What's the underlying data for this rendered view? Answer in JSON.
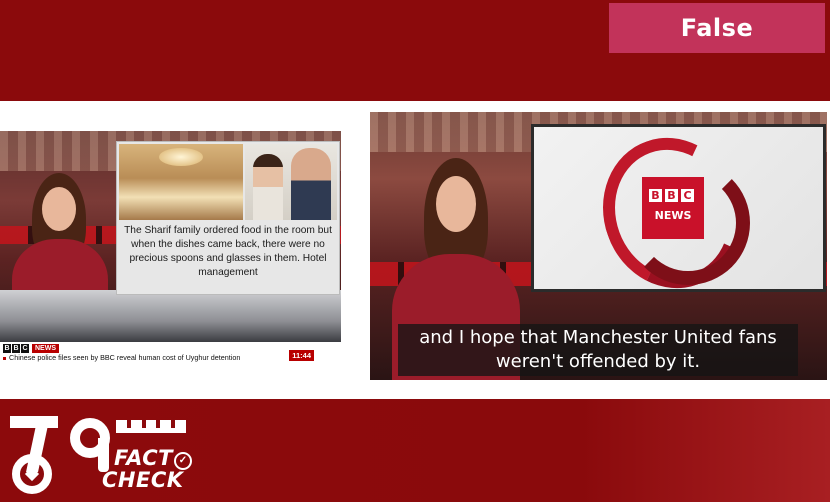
{
  "verdict": {
    "label": "False",
    "color": "#c2335a"
  },
  "left_frame": {
    "inset_caption": "The Sharif family ordered food in the room but when the dishes came back, there were no precious spoons and glasses in them. Hotel management",
    "channel_blocks": [
      "B",
      "B",
      "C"
    ],
    "channel_name": "NEWS",
    "ticker": "Chinese police files seen by BBC reveal human cost of Uyghur detention",
    "clock": "11:44"
  },
  "right_frame": {
    "screen_logo_blocks": [
      "B",
      "B",
      "C"
    ],
    "screen_logo_name": "NEWS",
    "subtitle_line1": "and I hope that Manchester United fans",
    "subtitle_line2": "weren't offended by it."
  },
  "brand": {
    "line1": "FACT",
    "line2": "CHECK",
    "check_icon": "check-circle-icon"
  },
  "colors": {
    "band": "#8b0a0c",
    "verdict_bg": "#c2335a",
    "bbc_red": "#b80000"
  }
}
